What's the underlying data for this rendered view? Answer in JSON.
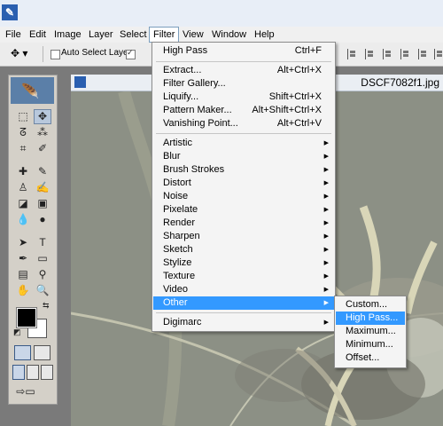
{
  "menubar": [
    "File",
    "Edit",
    "Image",
    "Layer",
    "Select",
    "Filter",
    "View",
    "Window",
    "Help"
  ],
  "options": {
    "auto_select_layer": "Auto Select Layer",
    "auto_select_checked": false,
    "second_checked": true
  },
  "document": {
    "title": "DSCF7082f1.jpg"
  },
  "filter_menu": {
    "last_filter": {
      "label": "High Pass",
      "shortcut": "Ctrl+F"
    },
    "group1": [
      {
        "label": "Extract...",
        "shortcut": "Alt+Ctrl+X"
      },
      {
        "label": "Filter Gallery...",
        "shortcut": ""
      },
      {
        "label": "Liquify...",
        "shortcut": "Shift+Ctrl+X"
      },
      {
        "label": "Pattern Maker...",
        "shortcut": "Alt+Shift+Ctrl+X"
      },
      {
        "label": "Vanishing Point...",
        "shortcut": "Alt+Ctrl+V"
      }
    ],
    "submenus": [
      "Artistic",
      "Blur",
      "Brush Strokes",
      "Distort",
      "Noise",
      "Pixelate",
      "Render",
      "Sharpen",
      "Sketch",
      "Stylize",
      "Texture",
      "Video",
      "Other"
    ],
    "highlighted": "Other",
    "last": "Digimarc"
  },
  "other_submenu": {
    "items": [
      "Custom...",
      "High Pass...",
      "Maximum...",
      "Minimum...",
      "Offset..."
    ],
    "highlighted": "High Pass..."
  },
  "colors": {
    "menu_highlight": "#3399ff",
    "foreground": "#000000",
    "background": "#ffffff"
  }
}
